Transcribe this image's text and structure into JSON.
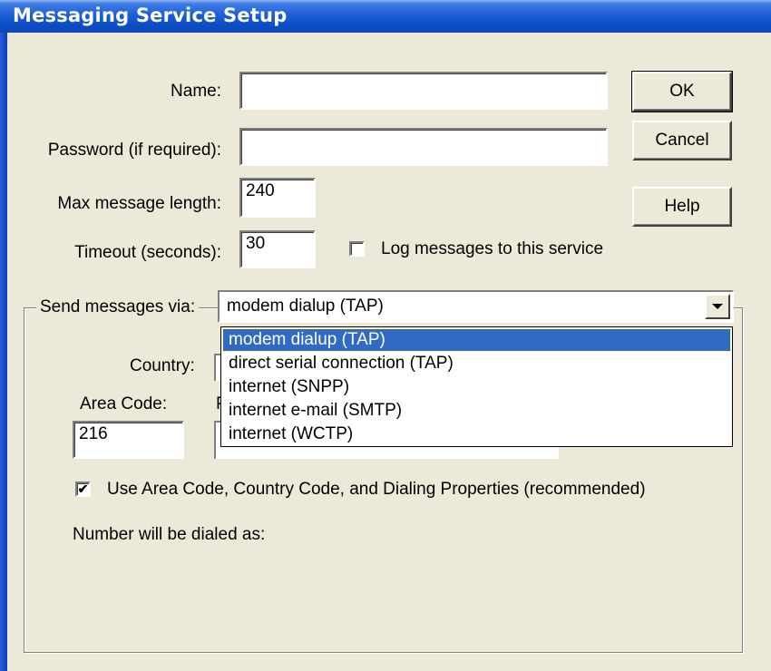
{
  "window": {
    "title": "Messaging Service Setup"
  },
  "form": {
    "name_label": "Name:",
    "name_value": "",
    "password_label": "Password (if required):",
    "password_value": "",
    "max_length_label": "Max message length:",
    "max_length_value": "240",
    "timeout_label": "Timeout (seconds):",
    "timeout_value": "30",
    "log_checkbox_label": "Log messages to this service",
    "log_checked": false
  },
  "buttons": {
    "ok": "OK",
    "cancel": "Cancel",
    "help": "Help"
  },
  "send_via": {
    "label": "Send messages via:",
    "selected": "modem dialup (TAP)",
    "options": [
      "modem dialup (TAP)",
      "direct serial connection (TAP)",
      "internet (SNPP)",
      "internet e-mail (SMTP)",
      "internet (WCTP)"
    ]
  },
  "dialing": {
    "country_label": "Country:",
    "area_code_label": "Area Code:",
    "area_code_value": "216",
    "phone_label_partial": "P",
    "use_area_code_label": "Use Area Code, Country Code, and Dialing Properties (recommended)",
    "use_area_code_checked": true,
    "dialed_as_label": "Number will be dialed as:"
  }
}
